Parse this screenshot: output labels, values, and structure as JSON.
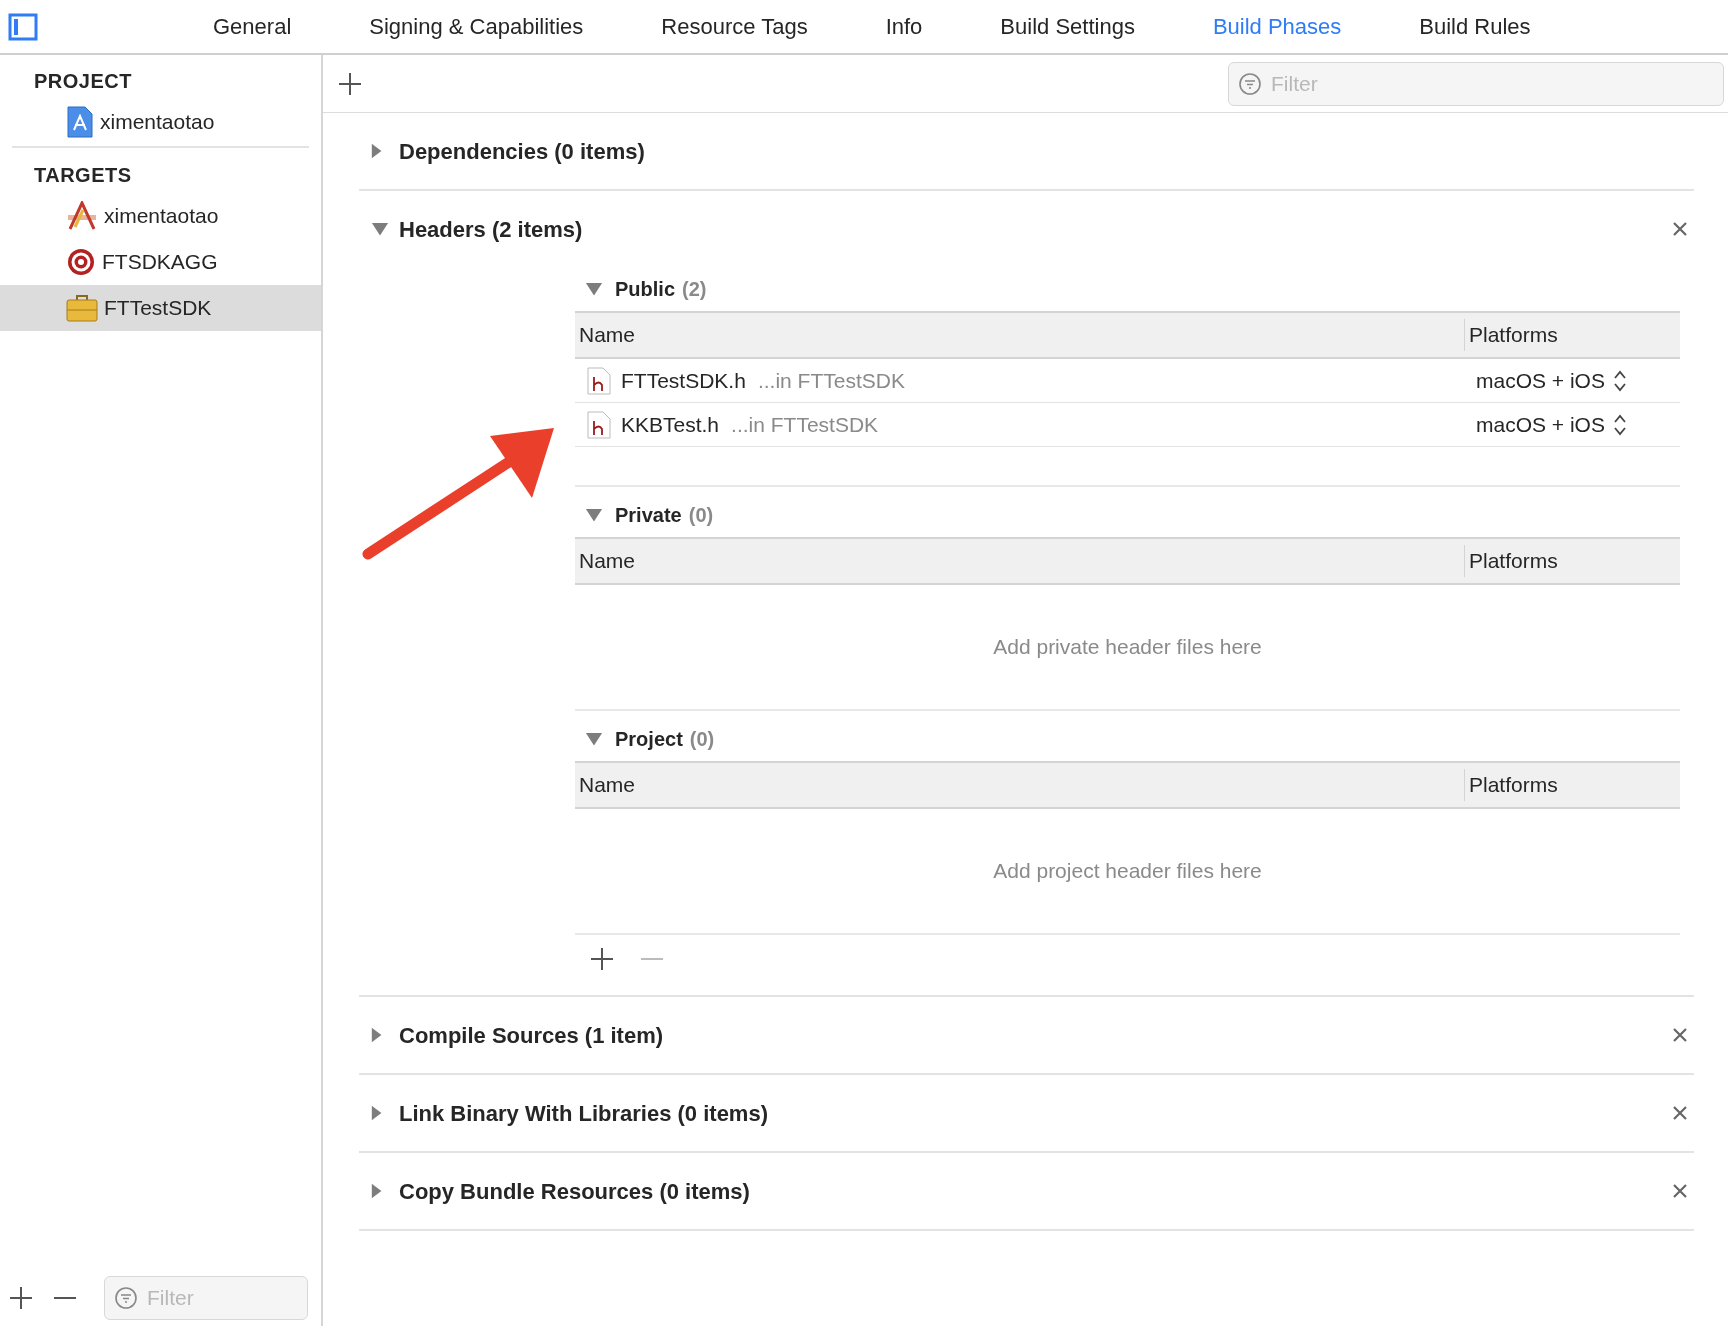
{
  "tabs": [
    {
      "label": "General",
      "selected": false
    },
    {
      "label": "Signing & Capabilities",
      "selected": false
    },
    {
      "label": "Resource Tags",
      "selected": false
    },
    {
      "label": "Info",
      "selected": false
    },
    {
      "label": "Build Settings",
      "selected": false
    },
    {
      "label": "Build Phases",
      "selected": true
    },
    {
      "label": "Build Rules",
      "selected": false
    }
  ],
  "sidebar": {
    "sections": [
      {
        "title": "PROJECT",
        "items": [
          {
            "label": "ximentaotao",
            "kind": "project",
            "selected": false
          }
        ]
      },
      {
        "title": "TARGETS",
        "items": [
          {
            "label": "ximentaotao",
            "kind": "app",
            "selected": false
          },
          {
            "label": "FTSDKAGG",
            "kind": "aggregate",
            "selected": false
          },
          {
            "label": "FTTestSDK",
            "kind": "framework",
            "selected": true
          }
        ]
      }
    ],
    "filter": {
      "placeholder": "Filter"
    }
  },
  "toolbar": {
    "filter": {
      "placeholder": "Filter"
    }
  },
  "phases": [
    {
      "title": "Dependencies (0 items)",
      "expanded": false,
      "removable": false
    },
    {
      "title": "Headers (2 items)",
      "expanded": true,
      "removable": true,
      "groups": [
        {
          "title": "Public",
          "count": "(2)",
          "columns": [
            "Name",
            "Platforms"
          ],
          "rows": [
            {
              "name": "FTTestSDK.h",
              "location": "...in FTTestSDK",
              "platforms": "macOS + iOS"
            },
            {
              "name": "KKBTest.h",
              "location": "...in FTTestSDK",
              "platforms": "macOS + iOS"
            }
          ]
        },
        {
          "title": "Private",
          "count": "(0)",
          "columns": [
            "Name",
            "Platforms"
          ],
          "empty_text": "Add private header files here"
        },
        {
          "title": "Project",
          "count": "(0)",
          "columns": [
            "Name",
            "Platforms"
          ],
          "empty_text": "Add project header files here"
        }
      ]
    },
    {
      "title": "Compile Sources (1 item)",
      "expanded": false,
      "removable": true
    },
    {
      "title": "Link Binary With Libraries (0 items)",
      "expanded": false,
      "removable": true
    },
    {
      "title": "Copy Bundle Resources (0 items)",
      "expanded": false,
      "removable": true
    }
  ]
}
